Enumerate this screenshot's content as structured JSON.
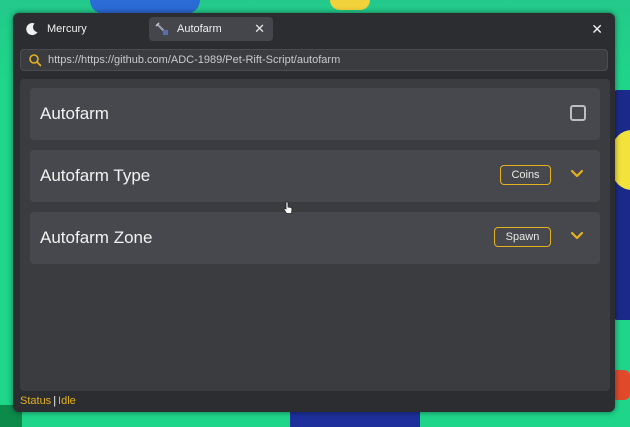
{
  "tabs": [
    {
      "label": "Mercury",
      "icon": "moon-icon"
    },
    {
      "label": "Autofarm",
      "icon": "tool-icon",
      "active": true
    }
  ],
  "address": {
    "value": "https://https://github.com/ADC-1989/Pet-Rift-Script/autofarm"
  },
  "rows": [
    {
      "label": "Autofarm",
      "control": "checkbox",
      "checked": false
    },
    {
      "label": "Autofarm Type",
      "control": "dropdown",
      "value": "Coins"
    },
    {
      "label": "Autofarm Zone",
      "control": "dropdown",
      "value": "Spawn"
    }
  ],
  "status": {
    "label": "Status",
    "separator": "|",
    "value": "Idle"
  },
  "colors": {
    "accent": "#e5b21c",
    "window": "#2c2d31",
    "panel": "#3b3c40",
    "row": "#47484d"
  }
}
